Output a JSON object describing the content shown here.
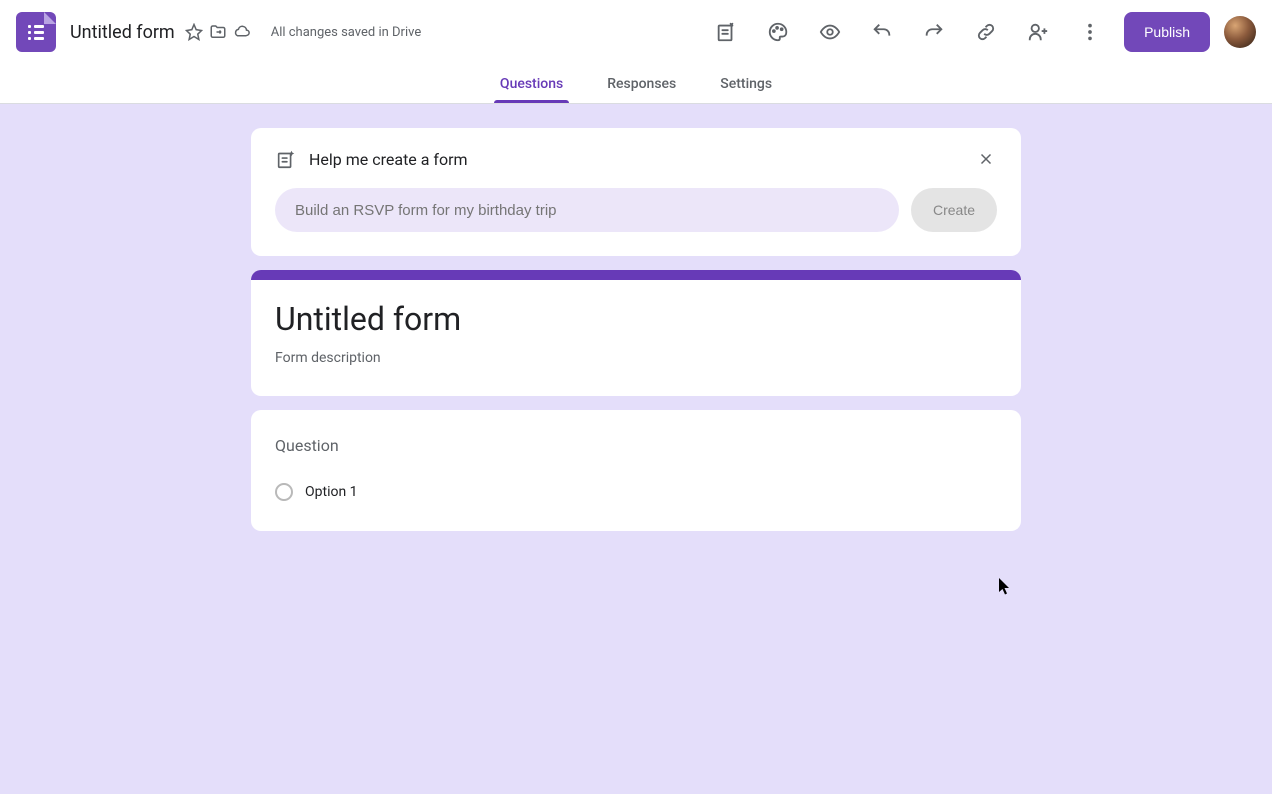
{
  "header": {
    "doc_title": "Untitled form",
    "save_status": "All changes saved in Drive",
    "publish_label": "Publish"
  },
  "tabs": {
    "questions": "Questions",
    "responses": "Responses",
    "settings": "Settings"
  },
  "ai": {
    "title": "Help me create a form",
    "placeholder": "Build an RSVP form for my birthday trip",
    "create_label": "Create"
  },
  "form": {
    "title": "Untitled form",
    "description": "Form description"
  },
  "question": {
    "title": "Question",
    "option1": "Option 1"
  },
  "colors": {
    "accent": "#673ab7",
    "canvas_bg": "#e4defa"
  }
}
